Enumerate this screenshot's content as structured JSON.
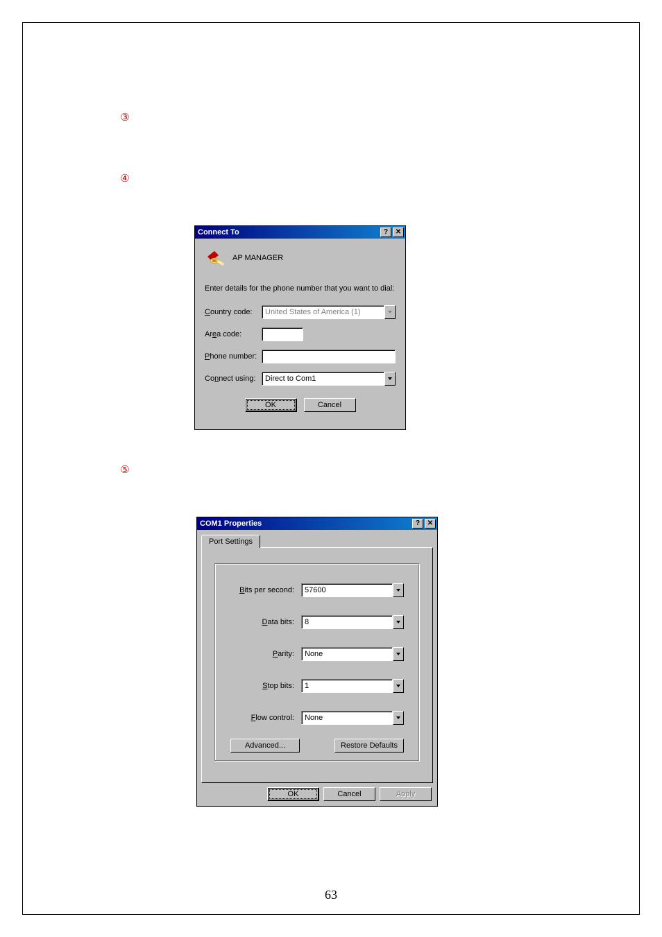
{
  "steps": {
    "s3": "③",
    "s4": "④",
    "s5": "⑤"
  },
  "page_number": "63",
  "dialog1": {
    "title": "Connect To",
    "help_glyph": "?",
    "close_glyph": "✕",
    "connection_name": "AP MANAGER",
    "instruction": "Enter details for the phone number that you want to dial:",
    "country_label": "Country code:",
    "country_value": "United States of America (1)",
    "area_label": "Area code:",
    "area_value": "",
    "phone_label": "Phone number:",
    "phone_value": "",
    "connect_label": "Connect using:",
    "connect_value": "Direct to Com1",
    "ok": "OK",
    "cancel": "Cancel"
  },
  "dialog2": {
    "title": "COM1 Properties",
    "help_glyph": "?",
    "close_glyph": "✕",
    "tab": "Port Settings",
    "bits_label": "Bits per second:",
    "bits_value": "57600",
    "data_label": "Data bits:",
    "data_value": "8",
    "parity_label": "Parity:",
    "parity_value": "None",
    "stop_label": "Stop bits:",
    "stop_value": "1",
    "flow_label": "Flow control:",
    "flow_value": "None",
    "advanced": "Advanced...",
    "restore": "Restore Defaults",
    "ok": "OK",
    "cancel": "Cancel",
    "apply": "Apply"
  }
}
